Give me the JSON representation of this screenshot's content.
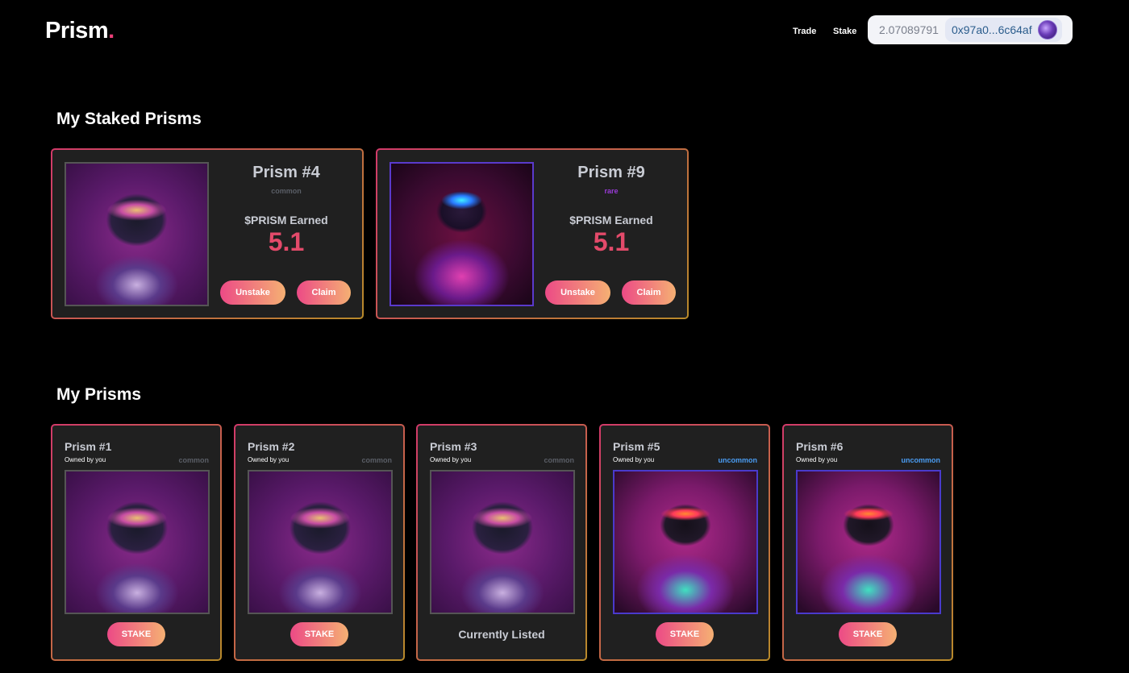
{
  "header": {
    "logo_text": "Prism",
    "logo_dot": ".",
    "nav": [
      {
        "label": "Trade"
      },
      {
        "label": "Stake"
      }
    ],
    "wallet": {
      "balance": "2.07089791",
      "address": "0x97a0...6c64af"
    }
  },
  "staked_section": {
    "title": "My Staked Prisms",
    "cards": [
      {
        "name": "Prism #4",
        "rarity": "common",
        "earned_label": "$PRISM Earned",
        "earned": "5.1",
        "unstake_label": "Unstake",
        "claim_label": "Claim"
      },
      {
        "name": "Prism #9",
        "rarity": "rare",
        "earned_label": "$PRISM Earned",
        "earned": "5.1",
        "unstake_label": "Unstake",
        "claim_label": "Claim"
      }
    ]
  },
  "owned_section": {
    "title": "My Prisms",
    "cards": [
      {
        "name": "Prism #1",
        "owner": "Owned by you",
        "rarity": "common",
        "action_label": "STAKE"
      },
      {
        "name": "Prism #2",
        "owner": "Owned by you",
        "rarity": "common",
        "action_label": "STAKE"
      },
      {
        "name": "Prism #3",
        "owner": "Owned by you",
        "rarity": "common",
        "status": "Currently Listed"
      },
      {
        "name": "Prism #5",
        "owner": "Owned by you",
        "rarity": "uncommon",
        "action_label": "STAKE"
      },
      {
        "name": "Prism #6",
        "owner": "Owned by you",
        "rarity": "uncommon",
        "action_label": "STAKE"
      }
    ]
  },
  "colors": {
    "accent_pink": "#ec3f78",
    "earned": "#e34a6a",
    "common": "#5a5e66",
    "rare": "#9a3bd8",
    "uncommon": "#4a9cf2"
  }
}
